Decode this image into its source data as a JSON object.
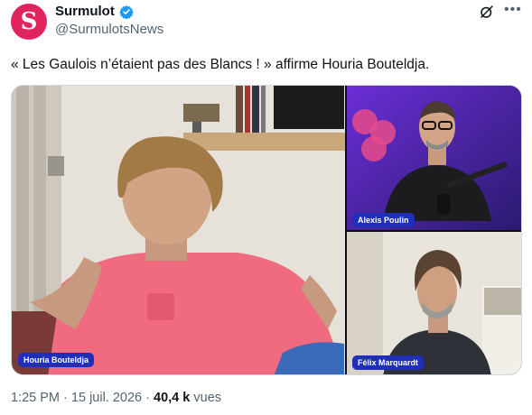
{
  "account": {
    "name": "Surmulot",
    "handle": "@SurmulotsNews",
    "avatar_letter": "S",
    "verified": true
  },
  "tweet": {
    "text": "« Les Gaulois n’étaient pas des Blancs ! » affirme Houria Bouteldja."
  },
  "video": {
    "speakers": [
      {
        "label": "Houria Bouteldja"
      },
      {
        "label": "Alexis Poulin"
      },
      {
        "label": "Félix Marquardt"
      }
    ]
  },
  "meta": {
    "time": "1:25 PM",
    "date": "15 juil. 2026",
    "views_count": "40,4 k",
    "views_label": "vues",
    "separator": "·"
  },
  "colors": {
    "avatar_bg": "#e0245e",
    "verified": "#1d9bf0",
    "name_tag_bg": "#1f2fb8",
    "secondary_text": "#536471"
  }
}
